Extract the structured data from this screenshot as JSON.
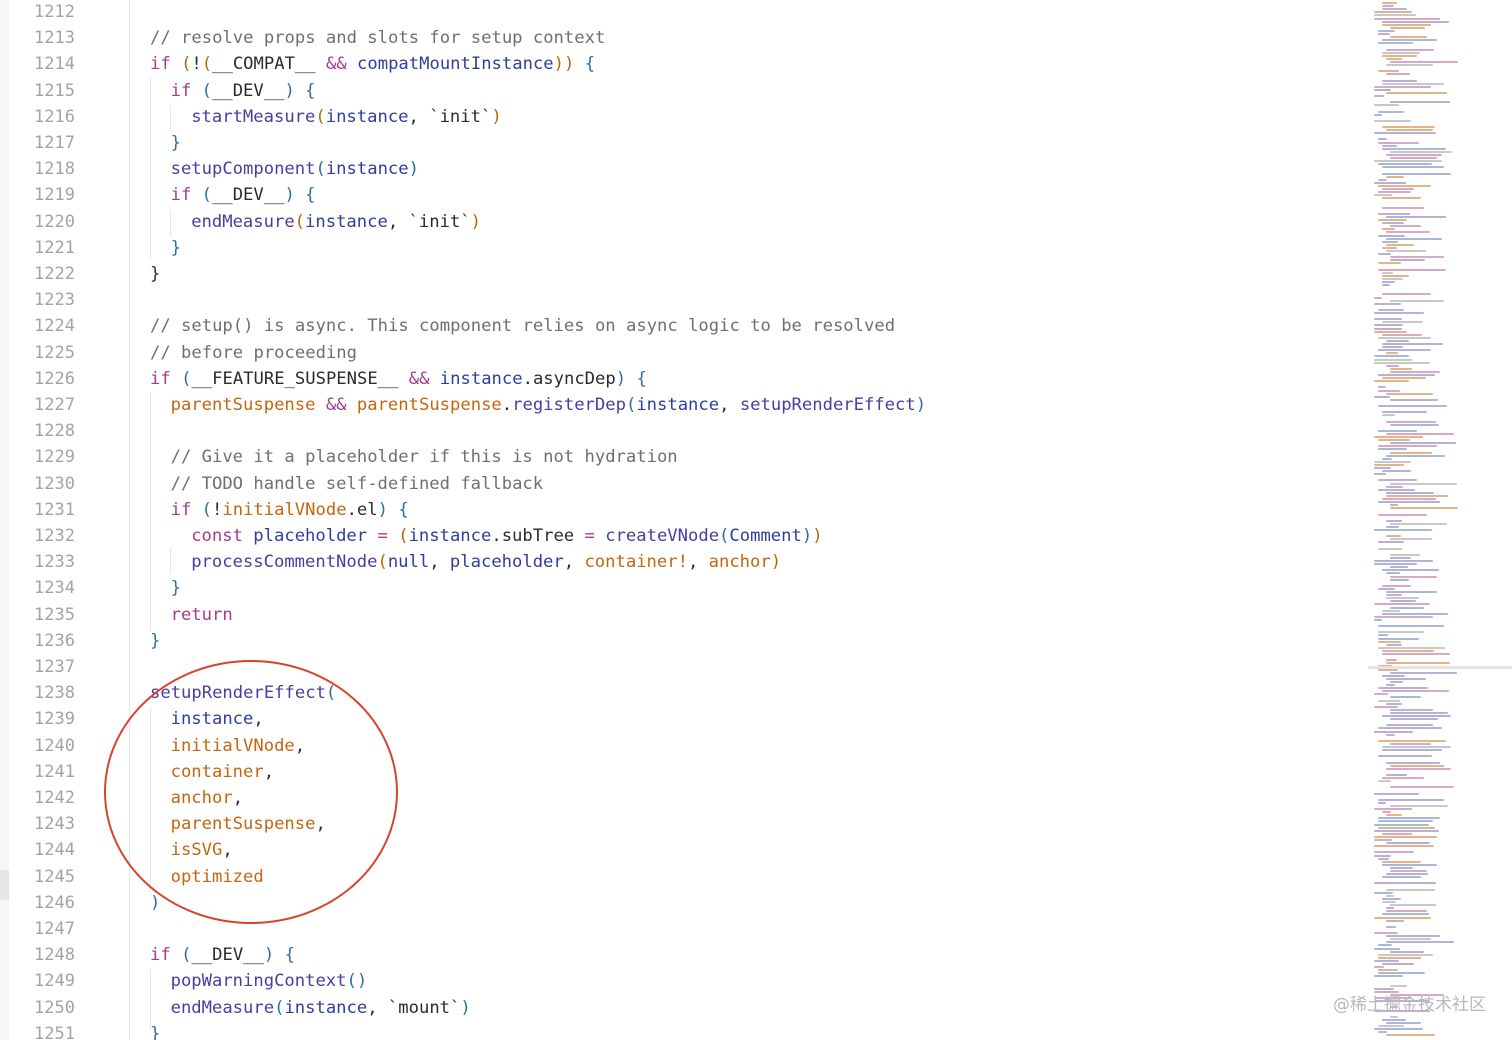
{
  "editor": {
    "first_line_number": 1212,
    "colors": {
      "keyword": "#a33d8e",
      "function": "#4b3ca0",
      "variable": "#2f3d9c",
      "parameter": "#c5660e",
      "comment": "#6f6f6f",
      "annotation_circle": "#d9432f"
    },
    "lines": [
      {
        "n": "1212",
        "indent": 0,
        "tokens": []
      },
      {
        "n": "1213",
        "indent": 0,
        "tokens": [
          [
            "cm",
            "// resolve props and slots for setup context"
          ]
        ]
      },
      {
        "n": "1214",
        "indent": 0,
        "tokens": [
          [
            "kw",
            "if"
          ],
          [
            "pun",
            " "
          ],
          [
            "br2",
            "("
          ],
          [
            "pun",
            "!"
          ],
          [
            "br2",
            "("
          ],
          [
            "pun",
            "__COMPAT__ "
          ],
          [
            "kw",
            "&&"
          ],
          [
            "pun",
            " "
          ],
          [
            "var",
            "compatMountInstance"
          ],
          [
            "br2",
            ")"
          ],
          [
            "br2",
            ")"
          ],
          [
            "pun",
            " "
          ],
          [
            "br",
            "{"
          ]
        ]
      },
      {
        "n": "1215",
        "indent": 1,
        "tokens": [
          [
            "kw",
            "if"
          ],
          [
            "pun",
            " "
          ],
          [
            "br",
            "("
          ],
          [
            "pun",
            "__DEV__"
          ],
          [
            "br",
            ")"
          ],
          [
            "pun",
            " "
          ],
          [
            "br",
            "{"
          ]
        ]
      },
      {
        "n": "1216",
        "indent": 2,
        "tokens": [
          [
            "fn",
            "startMeasure"
          ],
          [
            "br2",
            "("
          ],
          [
            "var",
            "instance"
          ],
          [
            "pun",
            ", `init`"
          ],
          [
            "br2",
            ")"
          ]
        ]
      },
      {
        "n": "1217",
        "indent": 1,
        "tokens": [
          [
            "br",
            "}"
          ]
        ]
      },
      {
        "n": "1218",
        "indent": 1,
        "tokens": [
          [
            "fn",
            "setupComponent"
          ],
          [
            "br",
            "("
          ],
          [
            "var",
            "instance"
          ],
          [
            "br",
            ")"
          ]
        ]
      },
      {
        "n": "1219",
        "indent": 1,
        "tokens": [
          [
            "kw",
            "if"
          ],
          [
            "pun",
            " "
          ],
          [
            "br",
            "("
          ],
          [
            "pun",
            "__DEV__"
          ],
          [
            "br",
            ")"
          ],
          [
            "pun",
            " "
          ],
          [
            "br",
            "{"
          ]
        ]
      },
      {
        "n": "1220",
        "indent": 2,
        "tokens": [
          [
            "fn",
            "endMeasure"
          ],
          [
            "br2",
            "("
          ],
          [
            "var",
            "instance"
          ],
          [
            "pun",
            ", `init`"
          ],
          [
            "br2",
            ")"
          ]
        ]
      },
      {
        "n": "1221",
        "indent": 1,
        "tokens": [
          [
            "br",
            "}"
          ]
        ]
      },
      {
        "n": "1222",
        "indent": 0,
        "tokens": [
          [
            "pun",
            "}"
          ]
        ]
      },
      {
        "n": "1223",
        "indent": 0,
        "tokens": []
      },
      {
        "n": "1224",
        "indent": 0,
        "tokens": [
          [
            "cm",
            "// setup() is async. This component relies on async logic to be resolved"
          ]
        ]
      },
      {
        "n": "1225",
        "indent": 0,
        "tokens": [
          [
            "cm",
            "// before proceeding"
          ]
        ]
      },
      {
        "n": "1226",
        "indent": 0,
        "tokens": [
          [
            "kw",
            "if"
          ],
          [
            "pun",
            " "
          ],
          [
            "br",
            "("
          ],
          [
            "pun",
            "__FEATURE_SUSPENSE__ "
          ],
          [
            "kw",
            "&&"
          ],
          [
            "pun",
            " "
          ],
          [
            "var",
            "instance"
          ],
          [
            "pun",
            ".asyncDep"
          ],
          [
            "br",
            ")"
          ],
          [
            "pun",
            " "
          ],
          [
            "br",
            "{"
          ]
        ]
      },
      {
        "n": "1227",
        "indent": 1,
        "tokens": [
          [
            "prm",
            "parentSuspense"
          ],
          [
            "pun",
            " "
          ],
          [
            "kw",
            "&&"
          ],
          [
            "pun",
            " "
          ],
          [
            "prm",
            "parentSuspense"
          ],
          [
            "pun",
            "."
          ],
          [
            "fn",
            "registerDep"
          ],
          [
            "br",
            "("
          ],
          [
            "var",
            "instance"
          ],
          [
            "pun",
            ", "
          ],
          [
            "fn",
            "setupRenderEffect"
          ],
          [
            "br",
            ")"
          ]
        ]
      },
      {
        "n": "1228",
        "indent": 1,
        "tokens": []
      },
      {
        "n": "1229",
        "indent": 1,
        "tokens": [
          [
            "cm",
            "// Give it a placeholder if this is not hydration"
          ]
        ]
      },
      {
        "n": "1230",
        "indent": 1,
        "tokens": [
          [
            "cm",
            "// TODO handle self-defined fallback"
          ]
        ]
      },
      {
        "n": "1231",
        "indent": 1,
        "tokens": [
          [
            "kw",
            "if"
          ],
          [
            "pun",
            " "
          ],
          [
            "br",
            "("
          ],
          [
            "pun",
            "!"
          ],
          [
            "prm",
            "initialVNode"
          ],
          [
            "pun",
            ".el"
          ],
          [
            "br",
            ")"
          ],
          [
            "pun",
            " "
          ],
          [
            "br",
            "{"
          ]
        ]
      },
      {
        "n": "1232",
        "indent": 2,
        "tokens": [
          [
            "kw",
            "const"
          ],
          [
            "pun",
            " "
          ],
          [
            "var",
            "placeholder"
          ],
          [
            "pun",
            " "
          ],
          [
            "kw",
            "="
          ],
          [
            "pun",
            " "
          ],
          [
            "br2",
            "("
          ],
          [
            "var",
            "instance"
          ],
          [
            "pun",
            ".subTree "
          ],
          [
            "kw",
            "="
          ],
          [
            "pun",
            " "
          ],
          [
            "fn",
            "createVNode"
          ],
          [
            "br",
            "("
          ],
          [
            "var",
            "Comment"
          ],
          [
            "br",
            ")"
          ],
          [
            "br2",
            ")"
          ]
        ]
      },
      {
        "n": "1233",
        "indent": 2,
        "tokens": [
          [
            "fn",
            "processCommentNode"
          ],
          [
            "br2",
            "("
          ],
          [
            "var",
            "null"
          ],
          [
            "pun",
            ", "
          ],
          [
            "var",
            "placeholder"
          ],
          [
            "pun",
            ", "
          ],
          [
            "prm",
            "container!"
          ],
          [
            "pun",
            ", "
          ],
          [
            "prm",
            "anchor"
          ],
          [
            "br2",
            ")"
          ]
        ]
      },
      {
        "n": "1234",
        "indent": 1,
        "tokens": [
          [
            "br",
            "}"
          ]
        ]
      },
      {
        "n": "1235",
        "indent": 1,
        "tokens": [
          [
            "kw",
            "return"
          ]
        ]
      },
      {
        "n": "1236",
        "indent": 0,
        "tokens": [
          [
            "br",
            "}"
          ]
        ]
      },
      {
        "n": "1237",
        "indent": 0,
        "tokens": []
      },
      {
        "n": "1238",
        "indent": 0,
        "tokens": [
          [
            "fn",
            "setupRenderEffect"
          ],
          [
            "br",
            "("
          ]
        ]
      },
      {
        "n": "1239",
        "indent": 1,
        "tokens": [
          [
            "var",
            "instance"
          ],
          [
            "pun",
            ","
          ]
        ]
      },
      {
        "n": "1240",
        "indent": 1,
        "tokens": [
          [
            "prm",
            "initialVNode"
          ],
          [
            "pun",
            ","
          ]
        ]
      },
      {
        "n": "1241",
        "indent": 1,
        "tokens": [
          [
            "prm",
            "container"
          ],
          [
            "pun",
            ","
          ]
        ]
      },
      {
        "n": "1242",
        "indent": 1,
        "tokens": [
          [
            "prm",
            "anchor"
          ],
          [
            "pun",
            ","
          ]
        ]
      },
      {
        "n": "1243",
        "indent": 1,
        "tokens": [
          [
            "prm",
            "parentSuspense"
          ],
          [
            "pun",
            ","
          ]
        ]
      },
      {
        "n": "1244",
        "indent": 1,
        "tokens": [
          [
            "prm",
            "isSVG"
          ],
          [
            "pun",
            ","
          ]
        ]
      },
      {
        "n": "1245",
        "indent": 1,
        "tokens": [
          [
            "prm",
            "optimized"
          ]
        ]
      },
      {
        "n": "1246",
        "indent": 0,
        "tokens": [
          [
            "br",
            ")"
          ]
        ]
      },
      {
        "n": "1247",
        "indent": 0,
        "tokens": []
      },
      {
        "n": "1248",
        "indent": 0,
        "tokens": [
          [
            "kw",
            "if"
          ],
          [
            "pun",
            " "
          ],
          [
            "br",
            "("
          ],
          [
            "pun",
            "__DEV__"
          ],
          [
            "br",
            ")"
          ],
          [
            "pun",
            " "
          ],
          [
            "br",
            "{"
          ]
        ]
      },
      {
        "n": "1249",
        "indent": 1,
        "tokens": [
          [
            "fn",
            "popWarningContext"
          ],
          [
            "br",
            "("
          ],
          [
            "br",
            ")"
          ]
        ]
      },
      {
        "n": "1250",
        "indent": 1,
        "tokens": [
          [
            "fn",
            "endMeasure"
          ],
          [
            "br",
            "("
          ],
          [
            "var",
            "instance"
          ],
          [
            "pun",
            ", `mount`"
          ],
          [
            "br",
            ")"
          ]
        ]
      },
      {
        "n": "1251",
        "indent": 0,
        "tokens": [
          [
            "br",
            "}"
          ]
        ]
      }
    ]
  },
  "watermark": "@稀土掘金技术社区",
  "minimap": {
    "viewport_line_fraction": 0.64
  }
}
